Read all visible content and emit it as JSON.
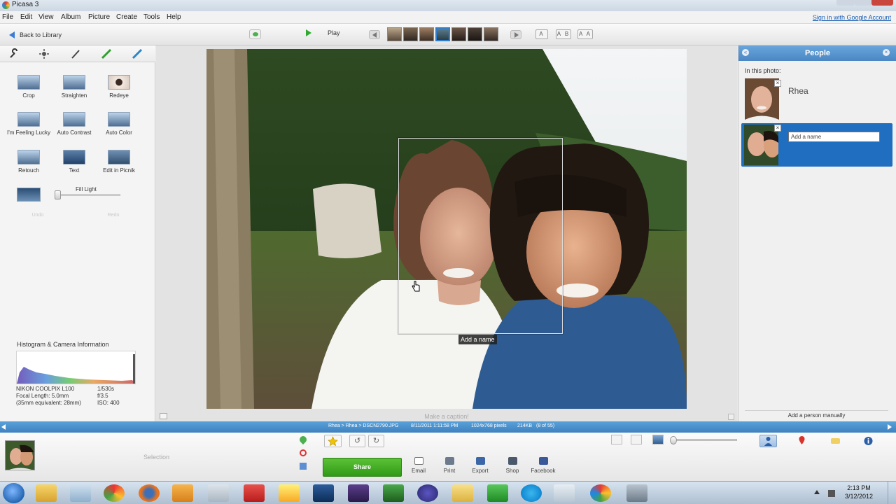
{
  "window": {
    "title": "Picasa 3"
  },
  "menu": {
    "items": [
      "File",
      "Edit",
      "View",
      "Album",
      "Picture",
      "Create",
      "Tools",
      "Help"
    ],
    "signin": "Sign in with Google Account"
  },
  "toolbar": {
    "back_label": "Back to Library",
    "play_label": "Play",
    "text_buttons": [
      "A",
      "A B",
      "A A"
    ]
  },
  "edit_panel": {
    "tools": [
      {
        "label": "Crop",
        "icon": "crop-icon"
      },
      {
        "label": "Straighten",
        "icon": "straighten-icon"
      },
      {
        "label": "Redeye",
        "icon": "redeye-icon"
      },
      {
        "label": "I'm Feeling Lucky",
        "icon": "lucky-icon"
      },
      {
        "label": "Auto Contrast",
        "icon": "contrast-icon"
      },
      {
        "label": "Auto Color",
        "icon": "color-icon"
      },
      {
        "label": "Retouch",
        "icon": "retouch-icon"
      },
      {
        "label": "Text",
        "icon": "text-icon"
      },
      {
        "label": "Edit in Picnik",
        "icon": "picnik-icon"
      }
    ],
    "fill_light_label": "Fill Light",
    "fill_light_value": 0,
    "undo_label": "Undo",
    "redo_label": "Redo"
  },
  "histogram": {
    "title": "Histogram & Camera Information",
    "camera": "NIKON COOLPIX L100",
    "focal": "Focal Length: 5.0mm",
    "equiv": "(35mm equivalent: 28mm)",
    "shutter": "1/530s",
    "aperture": "f/3.5",
    "iso": "ISO: 400"
  },
  "photo": {
    "caption_placeholder": "Make a caption!",
    "face_tag": "Add a name"
  },
  "people_panel": {
    "title": "People",
    "in_this_photo": "In this photo:",
    "person1_name": "Rhea",
    "name_placeholder": "Add a name",
    "add_person": "Add a person manually"
  },
  "status": {
    "path": "Rhea > Rhea > DSCN2790.JPG",
    "date": "8/11/2011 1:11:58 PM",
    "dimensions": "1024x768 pixels",
    "size": "214KB",
    "position": "(8 of 55)"
  },
  "tray": {
    "selection_label": "Selection",
    "share_label": "Share",
    "actions": [
      {
        "label": "Email",
        "icon": "email-icon"
      },
      {
        "label": "Print",
        "icon": "print-icon"
      },
      {
        "label": "Export",
        "icon": "export-icon"
      },
      {
        "label": "Shop",
        "icon": "shop-icon"
      },
      {
        "label": "Facebook",
        "icon": "facebook-icon"
      }
    ]
  },
  "taskbar": {
    "time": "2:13 PM",
    "date": "3/12/2012"
  },
  "colors": {
    "accent_blue": "#4a86c2",
    "share_green": "#3fab1f",
    "status_blue": "#4a90cc"
  }
}
